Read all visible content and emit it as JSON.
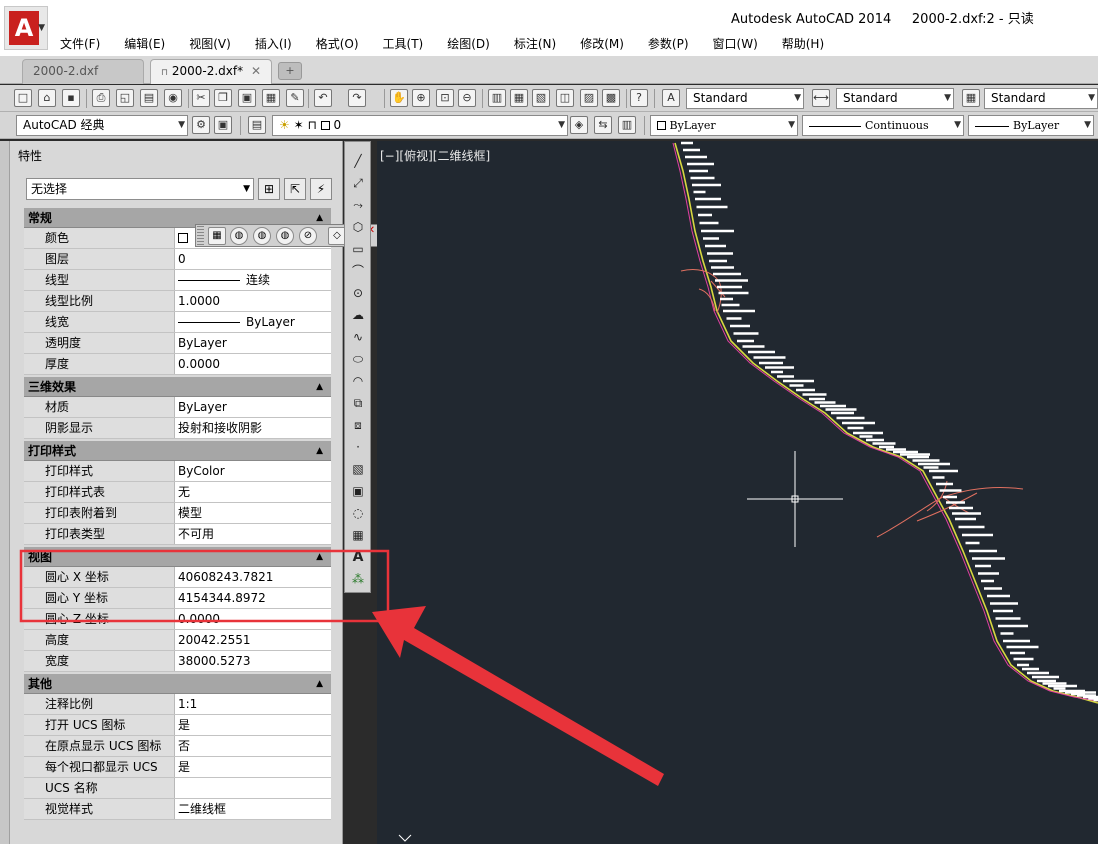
{
  "window": {
    "title": "Autodesk AutoCAD 2014     2000-2.dxf:2 - 只读",
    "app_button_letter": "A"
  },
  "menu": [
    "文件(F)",
    "编辑(E)",
    "视图(V)",
    "插入(I)",
    "格式(O)",
    "工具(T)",
    "绘图(D)",
    "标注(N)",
    "修改(M)",
    "参数(P)",
    "窗口(W)",
    "帮助(H)"
  ],
  "tabs": {
    "tab1": "2000-2.dxf",
    "tab2": "2000-2.dxf*",
    "tab2_close": "✕",
    "tab2_lock": "🔒"
  },
  "toolbar": {
    "text_style": "Standard",
    "dim_style": "Standard",
    "table_style": "Standard",
    "workspace": "AutoCAD 经典",
    "layer": "0",
    "color": "ByLayer",
    "linetype": "Continuous",
    "lineweight": "ByLayer"
  },
  "palette": {
    "title": "特性",
    "selection": "无选择",
    "sections": [
      {
        "name": "常规",
        "rows": [
          {
            "label": "颜色",
            "value": "",
            "kind": "color"
          },
          {
            "label": "图层",
            "value": "0"
          },
          {
            "label": "线型",
            "value": "连续",
            "kind": "line"
          },
          {
            "label": "线型比例",
            "value": "1.0000"
          },
          {
            "label": "线宽",
            "value": "ByLayer",
            "kind": "line"
          },
          {
            "label": "透明度",
            "value": "ByLayer"
          },
          {
            "label": "厚度",
            "value": "0.0000"
          }
        ]
      },
      {
        "name": "三维效果",
        "rows": [
          {
            "label": "材质",
            "value": "ByLayer"
          },
          {
            "label": "阴影显示",
            "value": "投射和接收阴影"
          }
        ]
      },
      {
        "name": "打印样式",
        "rows": [
          {
            "label": "打印样式",
            "value": "ByColor"
          },
          {
            "label": "打印样式表",
            "value": "无"
          },
          {
            "label": "打印表附着到",
            "value": "模型"
          },
          {
            "label": "打印表类型",
            "value": "不可用"
          }
        ]
      },
      {
        "name": "视图",
        "rows": [
          {
            "label": "圆心 X 坐标",
            "value": "40608243.7821"
          },
          {
            "label": "圆心 Y 坐标",
            "value": "4154344.8972"
          },
          {
            "label": "圆心 Z 坐标",
            "value": "0.0000"
          },
          {
            "label": "高度",
            "value": "20042.2551"
          },
          {
            "label": "宽度",
            "value": "38000.5273"
          }
        ]
      },
      {
        "name": "其他",
        "rows": [
          {
            "label": "注释比例",
            "value": "1:1"
          },
          {
            "label": "打开 UCS 图标",
            "value": "是"
          },
          {
            "label": "在原点显示 UCS 图标",
            "value": "否"
          },
          {
            "label": "每个视口都显示 UCS",
            "value": "是"
          },
          {
            "label": "UCS 名称",
            "value": ""
          },
          {
            "label": "视觉样式",
            "value": "二维线框"
          }
        ]
      }
    ]
  },
  "viewport": {
    "label": "[−][俯视][二维线框]"
  },
  "colors": {
    "canvas_bg": "#212830",
    "highlight": "#e8333a",
    "route_line": "#d8d840",
    "route_labels": "#ffffff",
    "interchange": "#e07060"
  }
}
